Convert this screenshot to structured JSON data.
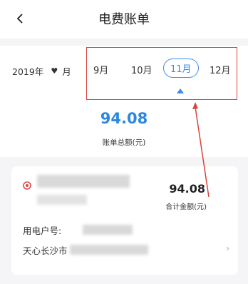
{
  "header": {
    "title": "电费账单"
  },
  "month_bar": {
    "year_label": "2019年",
    "month_unit": "月",
    "months": [
      "9月",
      "10月",
      "11月",
      "12月"
    ],
    "active_index": 2
  },
  "summary": {
    "total": "94.08",
    "total_label": "账单总额(元)"
  },
  "card": {
    "amount": "94.08",
    "amount_label": "合计金额(元)",
    "user_id_label": "用电户号:",
    "address_prefix": "天心长沙市"
  },
  "colors": {
    "accent": "#2b87e0",
    "annotation_red": "#d9443c"
  }
}
